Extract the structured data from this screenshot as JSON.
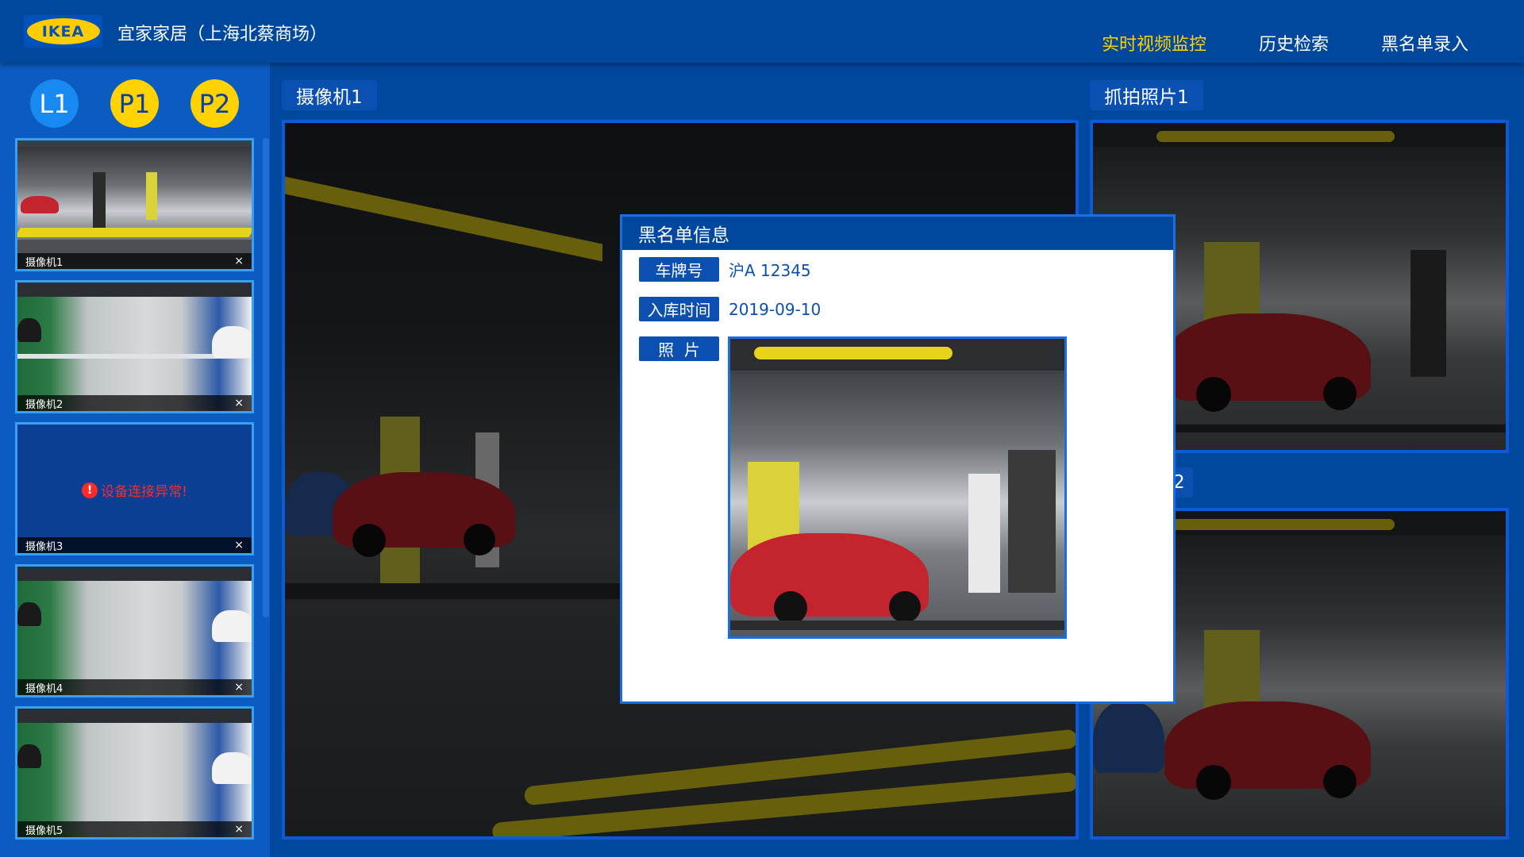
{
  "header": {
    "logo_text": "IKEA",
    "store_name": "宜家家居（上海北蔡商场）",
    "nav": [
      {
        "label": "实时视频监控",
        "active": true
      },
      {
        "label": "历史检索",
        "active": false
      },
      {
        "label": "黑名单录入",
        "active": false
      }
    ]
  },
  "sidebar": {
    "floors": [
      {
        "label": "L1",
        "active": true
      },
      {
        "label": "P1",
        "active": false
      },
      {
        "label": "P2",
        "active": false
      }
    ],
    "cameras": [
      {
        "label": "摄像机1",
        "close": "×",
        "status": "ok",
        "scene": "park"
      },
      {
        "label": "摄像机2",
        "close": "×",
        "status": "ok",
        "scene": "green-lot"
      },
      {
        "label": "摄像机3",
        "close": "×",
        "status": "error",
        "error_text": "设备连接异常!"
      },
      {
        "label": "摄像机4",
        "close": "×",
        "status": "ok",
        "scene": "green-lot"
      },
      {
        "label": "摄像机5",
        "close": "×",
        "status": "ok",
        "scene": "green-lot"
      }
    ]
  },
  "main": {
    "camera_tag": "摄像机1",
    "snapshot_tag_1": "抓拍照片1",
    "snapshot_tag_2_visible": "2"
  },
  "modal": {
    "title": "黑名单信息",
    "plate_label": "车牌号",
    "plate_value": "沪A 12345",
    "time_label": "入库时间",
    "time_value": "2019-09-10",
    "photo_label": "照  片"
  },
  "colors": {
    "header_bg": "#00489e",
    "sidebar_bg": "#0b5bc1",
    "active_nav": "#ffd200",
    "accent_blue": "#1789f0",
    "floor_inactive": "#ffd200",
    "error_red": "#ff2a2a"
  }
}
